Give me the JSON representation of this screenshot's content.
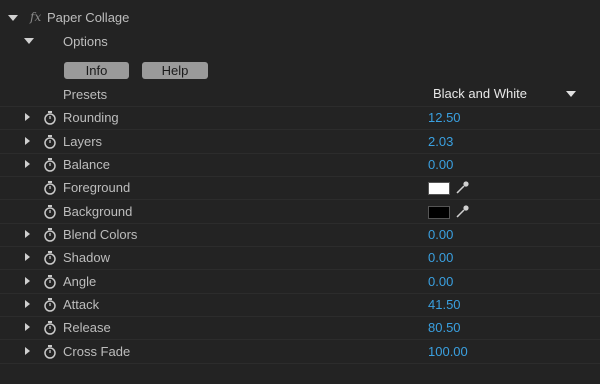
{
  "effect": {
    "fx_glyph": "fx",
    "name": "Paper Collage"
  },
  "options": {
    "label": "Options",
    "info_label": "Info",
    "help_label": "Help"
  },
  "presets": {
    "label": "Presets",
    "value": "Black and White"
  },
  "params": [
    {
      "label": "Rounding",
      "value": "12.50"
    },
    {
      "label": "Layers",
      "value": "2.03"
    },
    {
      "label": "Balance",
      "value": "0.00"
    },
    {
      "label": "Foreground",
      "color": "#ffffff"
    },
    {
      "label": "Background",
      "color": "#000000"
    },
    {
      "label": "Blend Colors",
      "value": "0.00"
    },
    {
      "label": "Shadow",
      "value": "0.00"
    },
    {
      "label": "Angle",
      "value": "0.00"
    },
    {
      "label": "Attack",
      "value": "41.50"
    },
    {
      "label": "Release",
      "value": "80.50"
    },
    {
      "label": "Cross Fade",
      "value": "100.00"
    }
  ],
  "colors": {
    "value_blue": "#3aa0e0",
    "panel_bg": "#232323"
  }
}
